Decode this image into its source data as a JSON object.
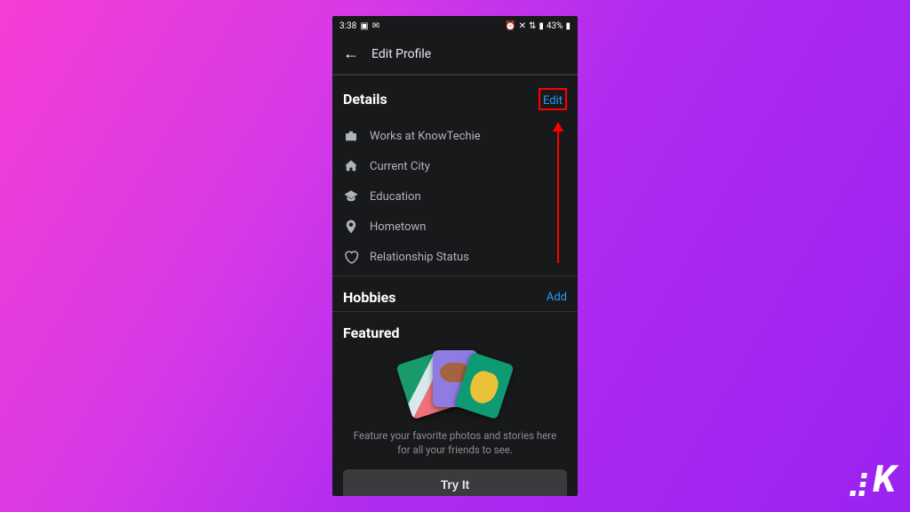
{
  "statusbar": {
    "time": "3:38",
    "battery": "43%"
  },
  "header": {
    "title": "Edit Profile"
  },
  "details": {
    "title": "Details",
    "edit": "Edit",
    "items": [
      {
        "label": "Works at KnowTechie",
        "icon": "briefcase"
      },
      {
        "label": "Current City",
        "icon": "home"
      },
      {
        "label": "Education",
        "icon": "gradcap"
      },
      {
        "label": "Hometown",
        "icon": "pin"
      },
      {
        "label": "Relationship Status",
        "icon": "heart"
      }
    ]
  },
  "hobbies": {
    "title": "Hobbies",
    "add": "Add"
  },
  "featured": {
    "title": "Featured",
    "description": "Feature your favorite photos and stories here for all your friends to see.",
    "cta": "Try It"
  },
  "watermark": "K"
}
